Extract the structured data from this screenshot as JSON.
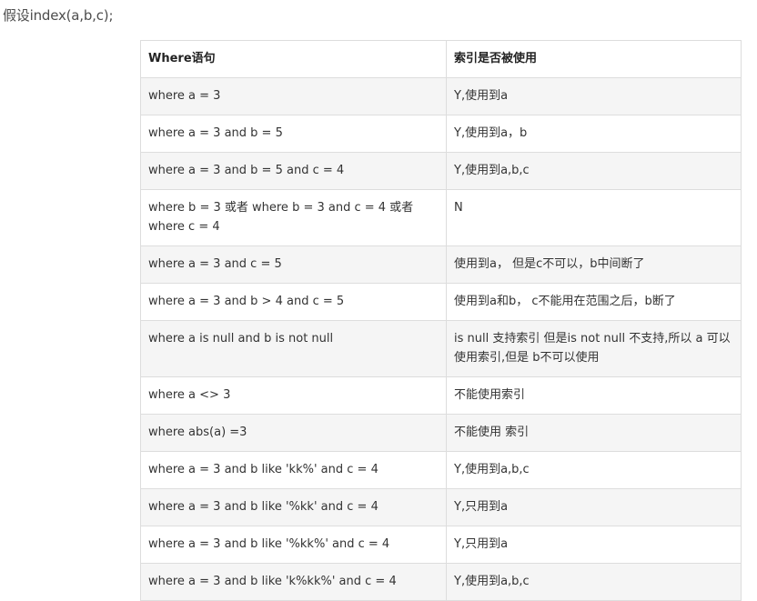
{
  "intro": "假设index(a,b,c);",
  "table": {
    "headers": [
      "Where语句",
      "索引是否被使用"
    ],
    "rows": [
      {
        "where": "where a = 3",
        "used": "Y,使用到a"
      },
      {
        "where": "where a = 3 and b = 5",
        "used": "Y,使用到a，b"
      },
      {
        "where": "where a = 3 and b = 5 and c = 4",
        "used": "Y,使用到a,b,c"
      },
      {
        "where": "where b = 3 或者 where b = 3 and c = 4  或者 where c = 4",
        "used": "N"
      },
      {
        "where": "where a = 3 and c = 5",
        "used": "使用到a， 但是c不可以，b中间断了"
      },
      {
        "where": "where a = 3 and b > 4 and c = 5",
        "used": "使用到a和b， c不能用在范围之后，b断了"
      },
      {
        "where": "where a is null and b is not null",
        "used": "  is null 支持索引 但是is not null 不支持,所以 a 可以使用索引,但是  b不可以使用"
      },
      {
        "where": "where a <> 3",
        "used": " 不能使用索引"
      },
      {
        "where": "where   abs(a) =3",
        "used": "不能使用 索引"
      },
      {
        "where": "where a = 3 and b like 'kk%' and c = 4",
        "used": "Y,使用到a,b,c"
      },
      {
        "where": "where a = 3 and b like '%kk' and c = 4",
        "used": "Y,只用到a"
      },
      {
        "where": "where a = 3 and b like '%kk%' and c = 4",
        "used": "Y,只用到a"
      },
      {
        "where": "where a = 3 and b like 'k%kk%' and c = 4",
        "used": "Y,使用到a,b,c"
      }
    ]
  }
}
